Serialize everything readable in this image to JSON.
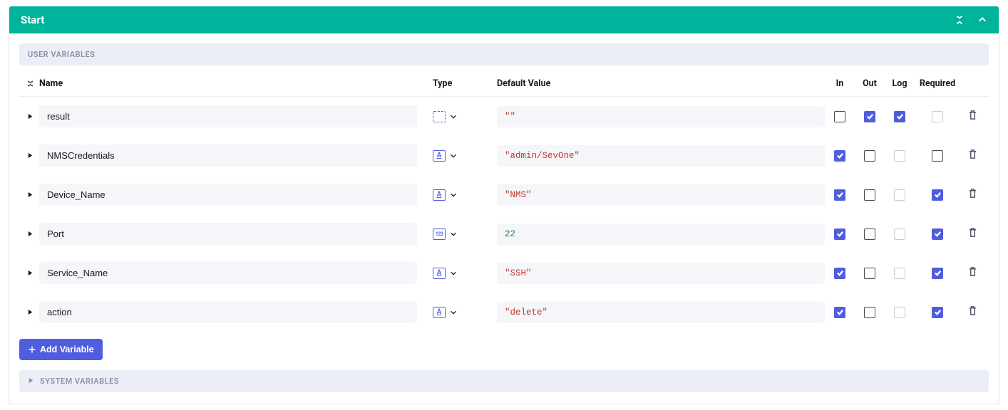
{
  "panel": {
    "title": "Start"
  },
  "sections": {
    "user": "USER VARIABLES",
    "system": "SYSTEM VARIABLES"
  },
  "columns": {
    "name": "Name",
    "type": "Type",
    "default": "Default Value",
    "in": "In",
    "out": "Out",
    "log": "Log",
    "required": "Required"
  },
  "variables": [
    {
      "name": "result",
      "type": "any",
      "default": "\"\"",
      "default_kind": "str",
      "in": false,
      "out": true,
      "log": true,
      "log_muted": false,
      "required": false,
      "required_muted": true
    },
    {
      "name": "NMSCredentials",
      "type": "string",
      "default": "\"admin/SevOne\"",
      "default_kind": "str",
      "in": true,
      "out": false,
      "log": false,
      "log_muted": true,
      "required": false,
      "required_muted": false
    },
    {
      "name": "Device_Name",
      "type": "string",
      "default": "\"NMS\"",
      "default_kind": "str",
      "in": true,
      "out": false,
      "log": false,
      "log_muted": true,
      "required": true,
      "required_muted": false
    },
    {
      "name": "Port",
      "type": "number",
      "default": "22",
      "default_kind": "num",
      "in": true,
      "out": false,
      "log": false,
      "log_muted": true,
      "required": true,
      "required_muted": false
    },
    {
      "name": "Service_Name",
      "type": "string",
      "default": "\"SSH\"",
      "default_kind": "str",
      "in": true,
      "out": false,
      "log": false,
      "log_muted": true,
      "required": true,
      "required_muted": false
    },
    {
      "name": "action",
      "type": "string",
      "default": "\"delete\"",
      "default_kind": "str",
      "in": true,
      "out": false,
      "log": false,
      "log_muted": true,
      "required": true,
      "required_muted": false
    }
  ],
  "buttons": {
    "add": "Add Variable"
  }
}
